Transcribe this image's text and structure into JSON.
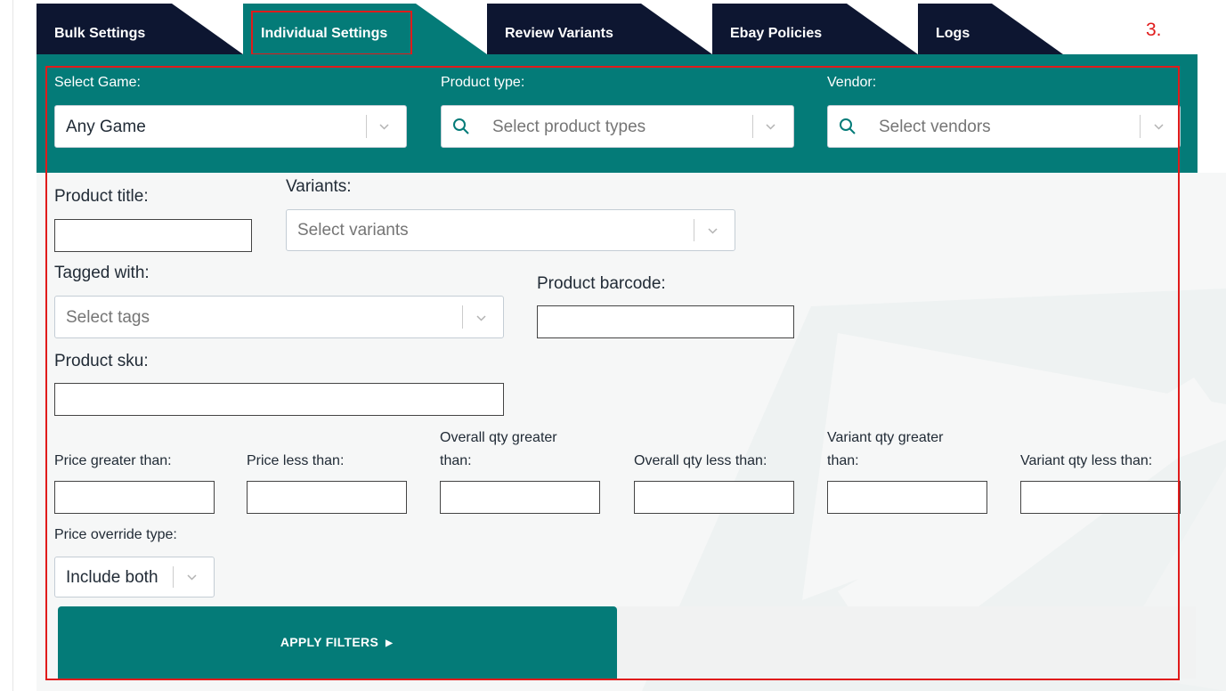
{
  "tabs": [
    {
      "label": "Bulk Settings"
    },
    {
      "label": "Individual Settings"
    },
    {
      "label": "Review Variants"
    },
    {
      "label": "Ebay Policies"
    },
    {
      "label": "Logs"
    }
  ],
  "annotation_number": "3.",
  "filters": {
    "game": {
      "label": "Select Game:",
      "value": "Any Game"
    },
    "product_type": {
      "label": "Product type:",
      "placeholder": "Select product types"
    },
    "vendor": {
      "label": "Vendor:",
      "placeholder": "Select vendors"
    }
  },
  "form": {
    "product_title": {
      "label": "Product title:",
      "value": ""
    },
    "variants": {
      "label": "Variants:",
      "placeholder": "Select variants"
    },
    "tagged_with": {
      "label": "Tagged with:",
      "placeholder": "Select tags"
    },
    "product_barcode": {
      "label": "Product barcode:",
      "value": ""
    },
    "product_sku": {
      "label": "Product sku:",
      "value": ""
    },
    "price_gt": {
      "label": "Price greater than:",
      "value": ""
    },
    "price_lt": {
      "label": "Price less than:",
      "value": ""
    },
    "overall_qty_gt": {
      "label_line1": "Overall qty greater",
      "label_line2": "than:",
      "value": ""
    },
    "overall_qty_lt": {
      "label": "Overall qty less than:",
      "value": ""
    },
    "variant_qty_gt": {
      "label_line1": "Variant qty greater",
      "label_line2": "than:",
      "value": ""
    },
    "variant_qty_lt": {
      "label": "Variant qty less than:",
      "value": ""
    },
    "price_override": {
      "label": "Price override type:",
      "value": "Include both"
    }
  },
  "apply_button": {
    "label": "APPLY FILTERS",
    "icon": "triangle-right-icon"
  },
  "colors": {
    "teal": "#047b78",
    "navy": "#0d1631",
    "annotation_red": "#e01b1b"
  }
}
